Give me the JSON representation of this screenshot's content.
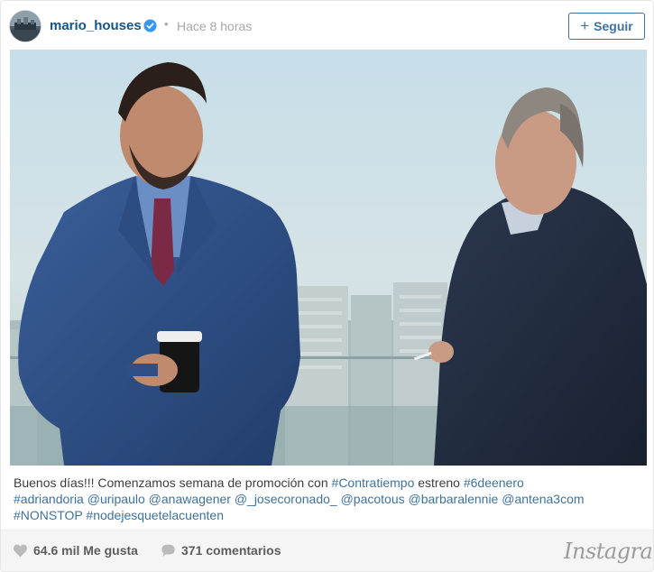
{
  "post": {
    "username": "mario_houses",
    "separator": "•",
    "timestamp": "Hace 8 horas",
    "follow_label": "Seguir",
    "follow_icon": "plus-icon",
    "verified_icon": "verified-badge-icon",
    "photo_alt": "Dos hombres con traje conversando en una azotea"
  },
  "caption": {
    "line1": [
      {
        "text": "Buenos días!!! Comenzamos semana de promoción con ",
        "tag": false
      },
      {
        "text": "#Contratiempo",
        "tag": true
      },
      {
        "text": " estreno ",
        "tag": false
      },
      {
        "text": "#6deenero",
        "tag": true
      }
    ],
    "line2": [
      {
        "text": "#adriandoria",
        "tag": true
      },
      {
        "text": " ",
        "tag": false
      },
      {
        "text": "@uripaulo",
        "tag": true
      },
      {
        "text": " ",
        "tag": false
      },
      {
        "text": "@anawagener",
        "tag": true
      },
      {
        "text": " ",
        "tag": false
      },
      {
        "text": "@_josecoronado_",
        "tag": true
      },
      {
        "text": " ",
        "tag": false
      },
      {
        "text": "@pacotous",
        "tag": true
      },
      {
        "text": " ",
        "tag": false
      },
      {
        "text": "@barbaralennie",
        "tag": true
      },
      {
        "text": " ",
        "tag": false
      },
      {
        "text": "@antena3com",
        "tag": true
      }
    ],
    "line3": [
      {
        "text": "#NONSTOP",
        "tag": true
      },
      {
        "text": " ",
        "tag": false
      },
      {
        "text": "#nodejesquetelacuenten",
        "tag": true
      }
    ]
  },
  "footer": {
    "likes": "64.6 mil Me gusta",
    "comments": "371 comentarios",
    "brand": "Instagram",
    "like_icon": "heart-icon",
    "comment_icon": "speech-bubble-icon"
  },
  "colors": {
    "link": "#3f729b",
    "username": "#125688",
    "muted": "#a5a7aa",
    "text": "#3d3d3d",
    "footer_bg": "#f5f5f5"
  }
}
